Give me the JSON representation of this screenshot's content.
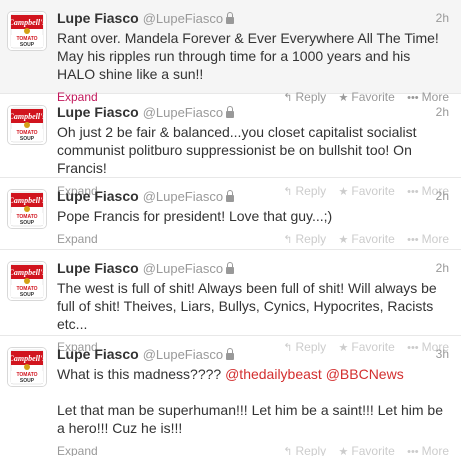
{
  "tweets": [
    {
      "fullname": "Lupe Fiasco",
      "username": "@LupeFiasco",
      "timestamp": "2h",
      "text": "Rant over. Mandela Forever & Ever Everywhere All The Time! May his ripples run through time for a 1000 years and his HALO shine like a sun!!",
      "expand": "Expand",
      "actions": {
        "reply": "Reply",
        "favorite": "Favorite",
        "more": "More"
      }
    },
    {
      "fullname": "Lupe Fiasco",
      "username": "@LupeFiasco",
      "timestamp": "2h",
      "text": "Oh just 2 be fair & balanced...you closet capitalist socialist communist politburo suppressionist be on bullshit too! On Francis!",
      "expand": "Expand",
      "actions": {
        "reply": "Reply",
        "favorite": "Favorite",
        "more": "More"
      }
    },
    {
      "fullname": "Lupe Fiasco",
      "username": "@LupeFiasco",
      "timestamp": "2h",
      "text": "Pope Francis for president! Love that guy...;)",
      "expand": "Expand",
      "actions": {
        "reply": "Reply",
        "favorite": "Favorite",
        "more": "More"
      }
    },
    {
      "fullname": "Lupe Fiasco",
      "username": "@LupeFiasco",
      "timestamp": "2h",
      "text": "The west is full of shit! Always been full of shit! Will always be full of shit! Theives, Liars, Bullys, Cynics, Hypocrites, Racists etc...",
      "expand": "Expand",
      "actions": {
        "reply": "Reply",
        "favorite": "Favorite",
        "more": "More"
      }
    },
    {
      "fullname": "Lupe Fiasco",
      "username": "@LupeFiasco",
      "timestamp": "3h",
      "text_prefix": "What is this madness???? ",
      "mention_1": "@thedailybeast",
      "mention_2": "@BBCNews",
      "text_rest": "Let that man be superhuman!!! Let him be a saint!!! Let him be a hero!!! Cuz he is!!!",
      "expand": "Expand",
      "actions": {
        "reply": "Reply",
        "favorite": "Favorite",
        "more": "More"
      }
    }
  ],
  "icons": {
    "avatar": "campbells-soup-can-icon",
    "reply": "reply-arrow-icon",
    "favorite": "star-icon",
    "more": "ellipsis-icon",
    "lock": "lock-icon"
  },
  "colors": {
    "expand_active": "#c2185b",
    "mention": "#d32f2f",
    "selected_background": "#f5f5f5"
  }
}
